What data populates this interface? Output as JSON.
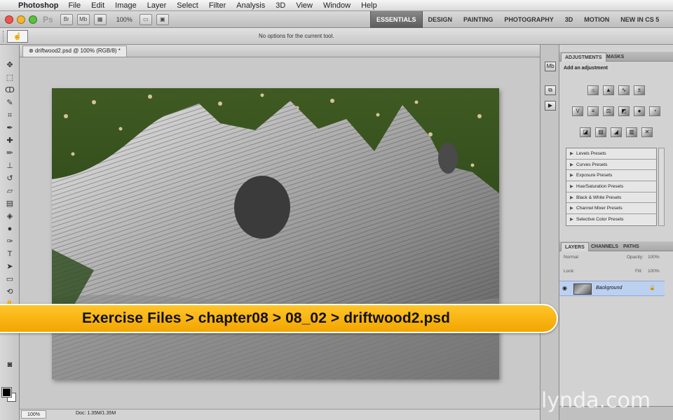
{
  "menubar": {
    "app": "Photoshop",
    "items": [
      "File",
      "Edit",
      "Image",
      "Layer",
      "Select",
      "Filter",
      "Analysis",
      "3D",
      "View",
      "Window",
      "Help"
    ]
  },
  "appbar": {
    "logo": "Ps",
    "zoom": "100%",
    "workspaces": [
      "ESSENTIALS",
      "DESIGN",
      "PAINTING",
      "PHOTOGRAPHY",
      "3D",
      "MOTION",
      "NEW IN CS 5"
    ],
    "active_workspace": "ESSENTIALS"
  },
  "options": {
    "message": "No options for the current tool."
  },
  "document": {
    "tab": "driftwood2.psd @ 100% (RGB/8) *",
    "status_zoom": "100%",
    "status_doc": "Doc: 1.35M/1.35M"
  },
  "adjustments": {
    "tabs": [
      "ADJUSTMENTS",
      "MASKS"
    ],
    "heading": "Add an adjustment",
    "presets": [
      "Levels Presets",
      "Curves Presets",
      "Exposure Presets",
      "Hue/Saturation Presets",
      "Black & White Presets",
      "Channel Mixer Presets",
      "Selective Color Presets"
    ]
  },
  "layers": {
    "tabs": [
      "LAYERS",
      "CHANNELS",
      "PATHS"
    ],
    "blend_mode": "Normal",
    "opacity_label": "Opacity:",
    "opacity": "100%",
    "lock_label": "Lock:",
    "fill_label": "Fill:",
    "fill": "100%",
    "layer_name": "Background"
  },
  "banner": {
    "text": "Exercise Files > chapter08 > 08_02 > driftwood2.psd"
  },
  "watermark": {
    "text": "lynda.com"
  },
  "colors": {
    "banner": "#f7b500",
    "layer_selected": "#bcd0f0"
  }
}
